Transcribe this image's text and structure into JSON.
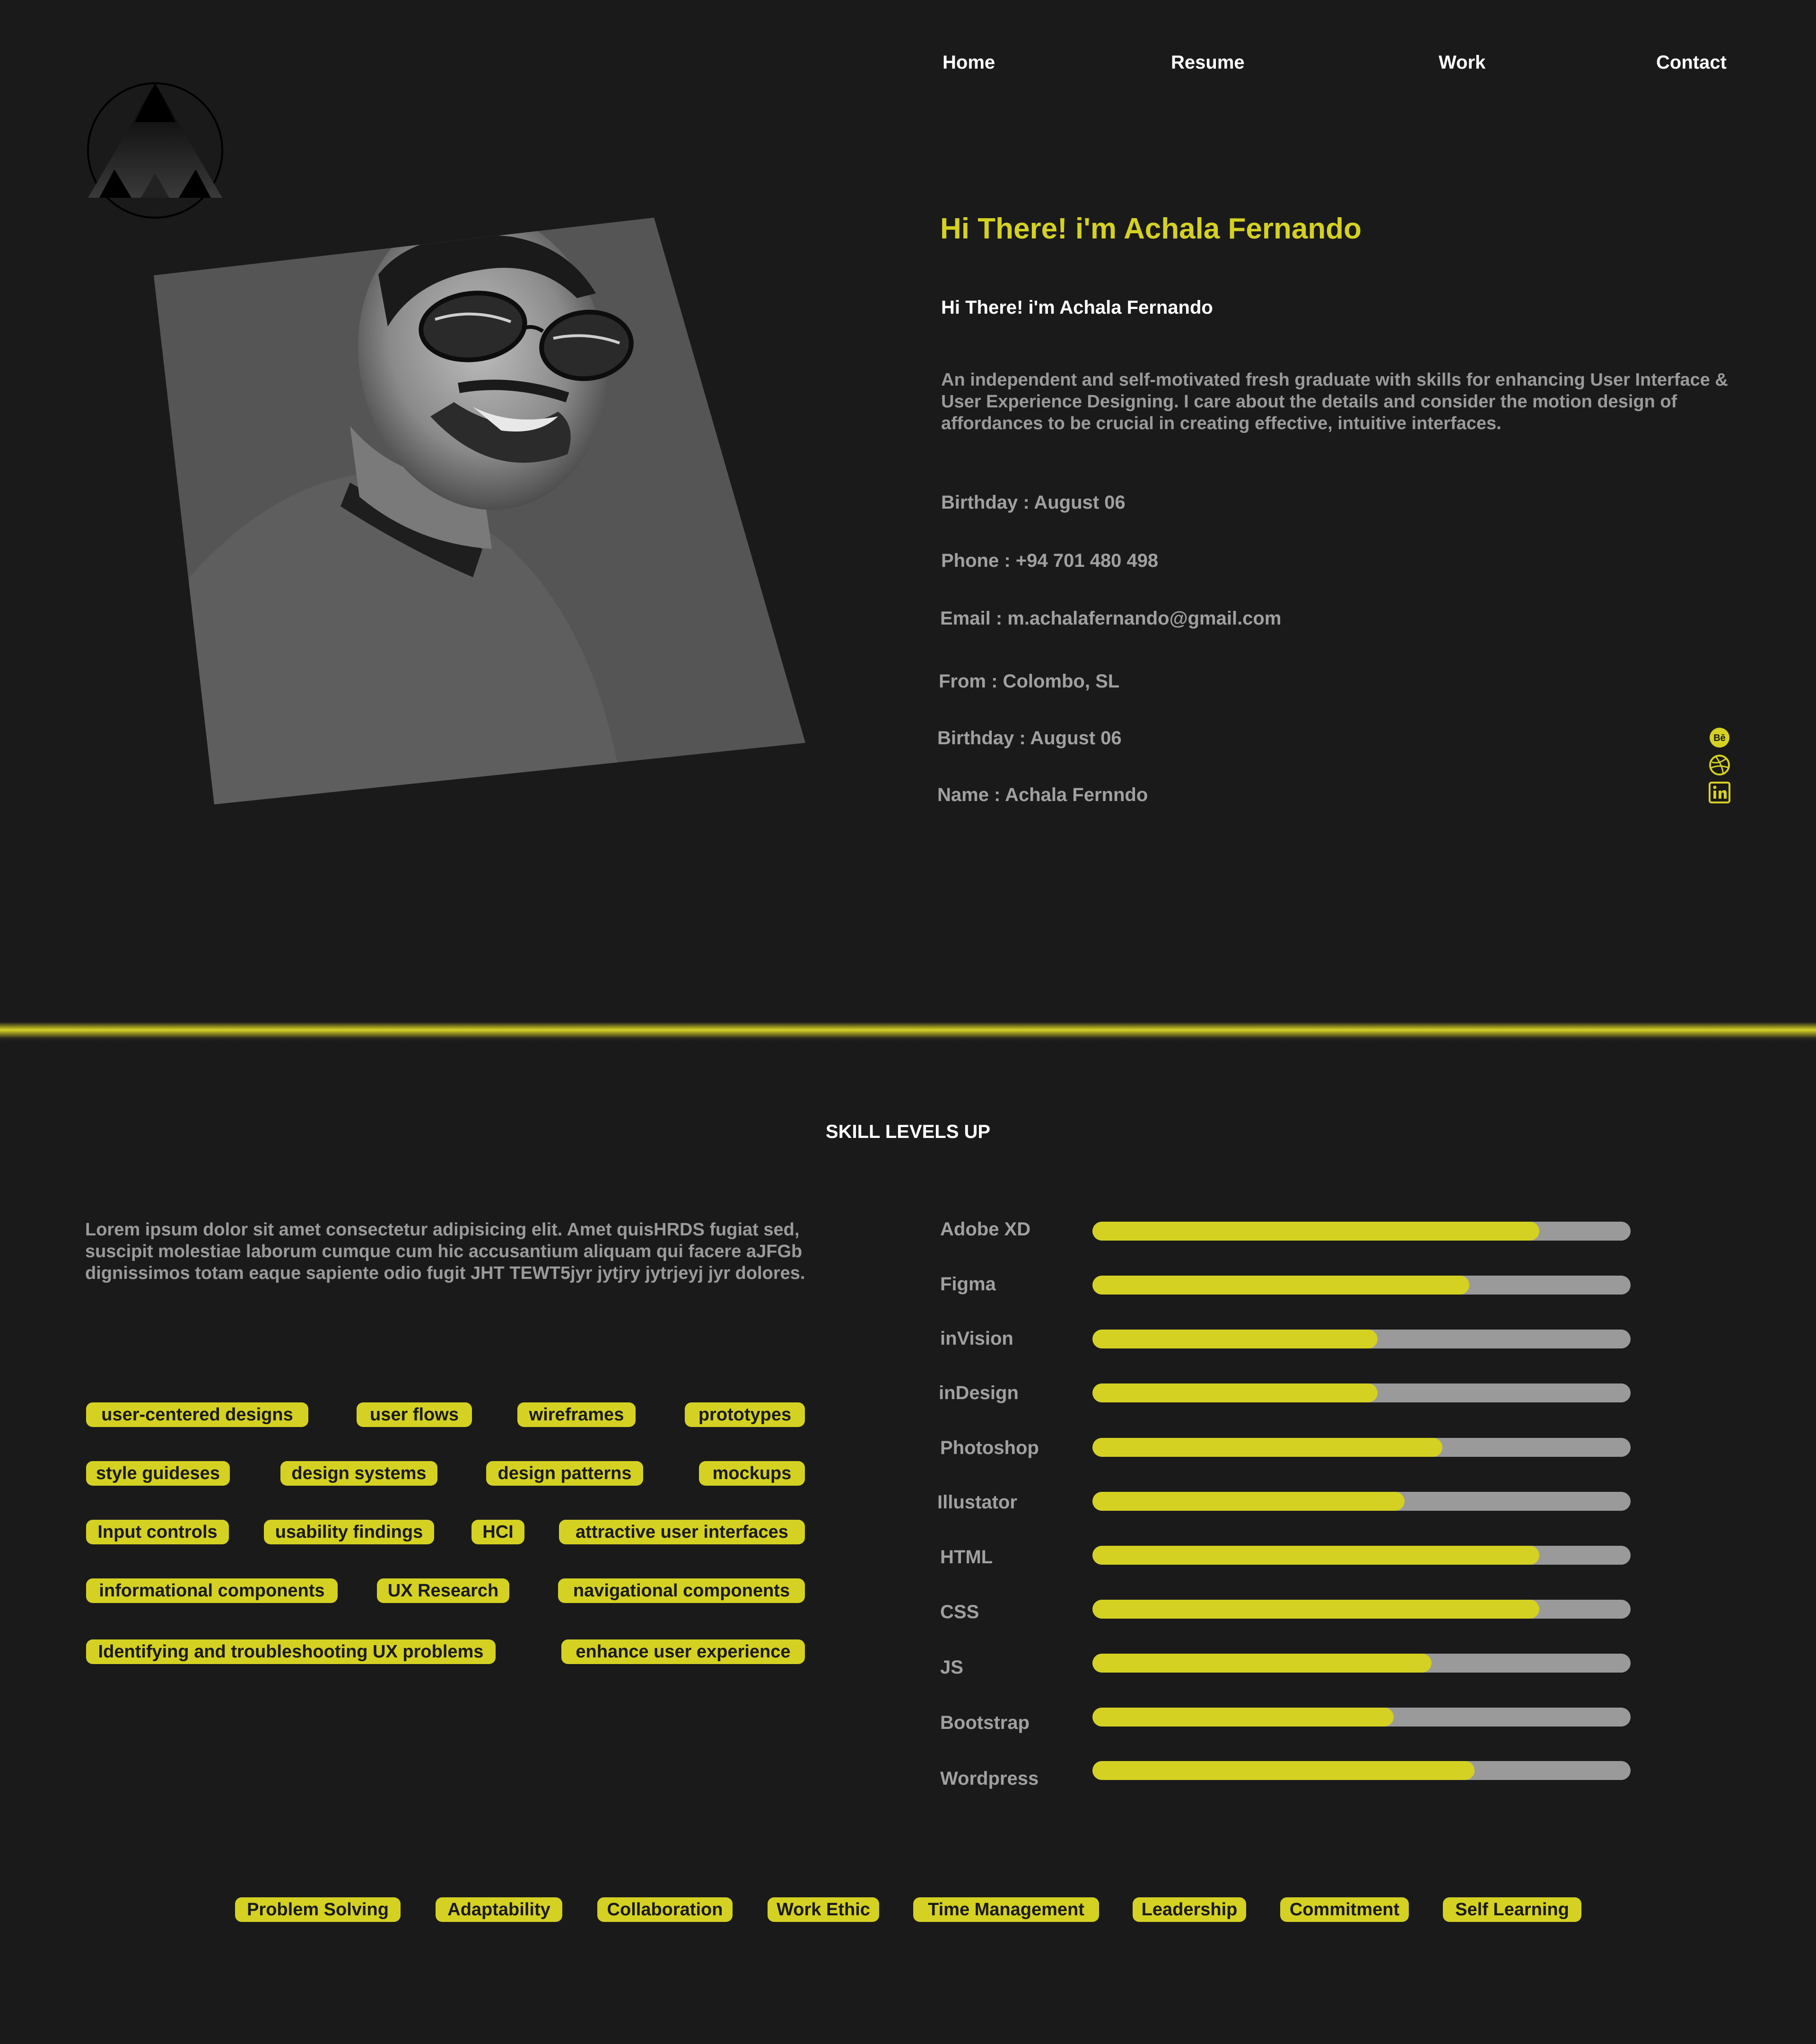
{
  "colors": {
    "accent": "#d4d123",
    "background": "#1a1a1a",
    "track": "#9a9a9a",
    "muted_text": "#a0a0a0"
  },
  "nav": {
    "items": [
      "Home",
      "Resume",
      "Work",
      "Contact"
    ]
  },
  "logo": {
    "icon": "triangle-logo-icon"
  },
  "hero": {
    "title": "Hi There! i'm Achala Fernando",
    "subtitle": "Hi There! i'm Achala Fernando",
    "bio": "An independent and self-motivated fresh graduate with skills for enhancing User Interface & User Experience Designing. I care about the details and consider the motion design of affordances to be crucial in creating effective, intuitive interfaces.",
    "info": [
      "Birthday : August 06",
      "Phone : +94 701 480 498",
      "Email : m.achalafernando@gmail.com",
      "From : Colombo, SL",
      "Birthday : August 06",
      "Name : Achala Fernndo"
    ]
  },
  "social": [
    "behance-icon",
    "dribbble-icon",
    "linkedin-icon"
  ],
  "skills": {
    "title": "SKILL LEVELS UP",
    "description": "Lorem ipsum dolor sit amet consectetur adipisicing elit. Amet quisHRDS fugiat sed, suscipit molestiae laborum cumque cum hic accusantium aliquam qui facere aJFGb dignissimos totam eaque sapiente odio fugit JHT TEWT5jyr jytjry jytrjeyj jyr dolores.",
    "tags": [
      "user-centered designs",
      "user flows",
      "wireframes",
      "prototypes",
      "style guideses",
      "design systems",
      "design patterns",
      "mockups",
      "Input controls",
      "usability findings",
      "HCI",
      "attractive user interfaces",
      "informational components",
      "UX Research",
      "navigational components",
      "Identifying and troubleshooting UX problems",
      "enhance user experience"
    ],
    "levels": [
      {
        "name": "Adobe XD",
        "level": 0.83
      },
      {
        "name": "Figma",
        "level": 0.7
      },
      {
        "name": "inVision",
        "level": 0.53
      },
      {
        "name": "inDesign",
        "level": 0.53
      },
      {
        "name": "Photoshop",
        "level": 0.65
      },
      {
        "name": "Illustator",
        "level": 0.58
      },
      {
        "name": "HTML",
        "level": 0.83
      },
      {
        "name": "CSS",
        "level": 0.83
      },
      {
        "name": "JS",
        "level": 0.63
      },
      {
        "name": "Bootstrap",
        "level": 0.56
      },
      {
        "name": "Wordpress",
        "level": 0.71
      }
    ],
    "soft_skills": [
      "Problem Solving",
      "Adaptability",
      "Collaboration",
      "Work Ethic",
      "Time Management",
      "Leadership",
      "Commitment",
      "Self Learning"
    ]
  }
}
